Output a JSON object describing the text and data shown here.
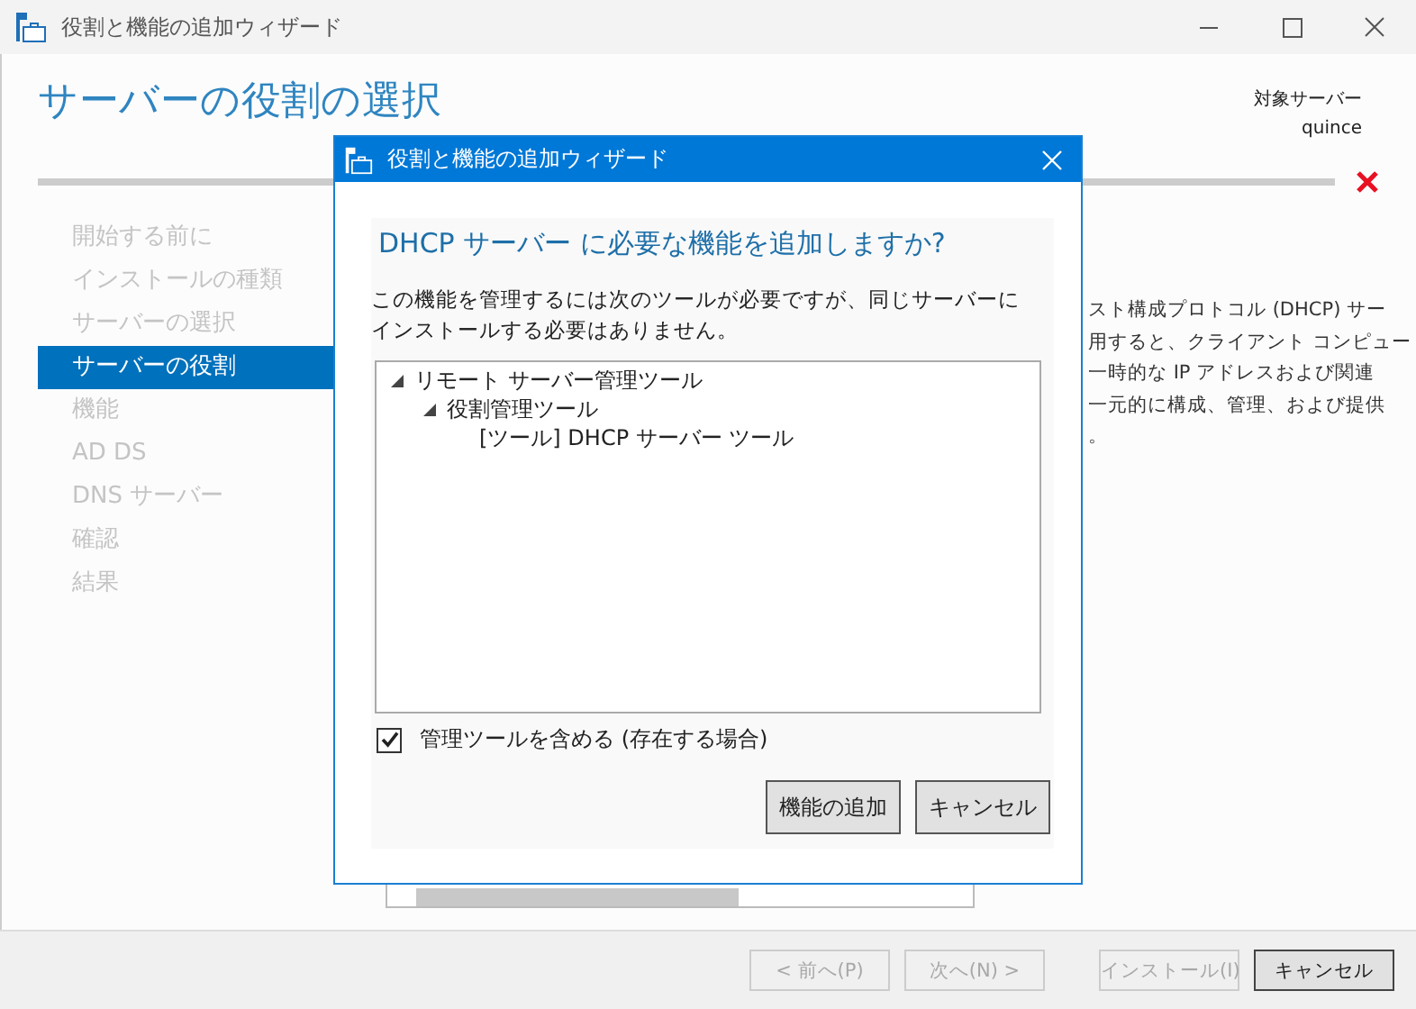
{
  "window": {
    "title": "役割と機能の追加ウィザード"
  },
  "header": {
    "title": "サーバーの役割の選択",
    "target_label": "対象サーバー",
    "target_server": "quince"
  },
  "sidebar": {
    "items": [
      {
        "label": "開始する前に",
        "selected": false
      },
      {
        "label": "インストールの種類",
        "selected": false
      },
      {
        "label": "サーバーの選択",
        "selected": false
      },
      {
        "label": "サーバーの役割",
        "selected": true
      },
      {
        "label": "機能",
        "selected": false
      },
      {
        "label": "AD DS",
        "selected": false
      },
      {
        "label": "DNS サーバー",
        "selected": false
      },
      {
        "label": "確認",
        "selected": false
      },
      {
        "label": "結果",
        "selected": false
      }
    ]
  },
  "description": {
    "lines": [
      "スト構成プロトコル (DHCP) サー",
      "用すると、クライアント コンピュー",
      "一時的な IP アドレスおよび関連",
      "一元的に構成、管理、および提供",
      "。"
    ]
  },
  "footer": {
    "buttons": [
      {
        "label": "< 前へ(P)",
        "disabled": true,
        "default": false
      },
      {
        "label": "次へ(N) >",
        "disabled": true,
        "default": false
      },
      {
        "label": "インストール(I)",
        "disabled": true,
        "default": false
      },
      {
        "label": "キャンセル",
        "disabled": false,
        "default": true
      }
    ]
  },
  "dialog": {
    "title": "役割と機能の追加ウィザード",
    "heading": "DHCP サーバー に必要な機能を追加しますか?",
    "message": "この機能を管理するには次のツールが必要ですが、同じサーバーにインストールする必要はありません。",
    "tree": [
      {
        "label": "リモート サーバー管理ツール",
        "expanded": true,
        "children": [
          {
            "label": "役割管理ツール",
            "expanded": true,
            "children": [
              {
                "label": "[ツール] DHCP サーバー ツール"
              }
            ]
          }
        ]
      }
    ],
    "include_tools": {
      "label": "管理ツールを含める (存在する場合)",
      "checked": true
    },
    "buttons": [
      {
        "label": "機能の追加"
      },
      {
        "label": "キャンセル"
      }
    ]
  }
}
